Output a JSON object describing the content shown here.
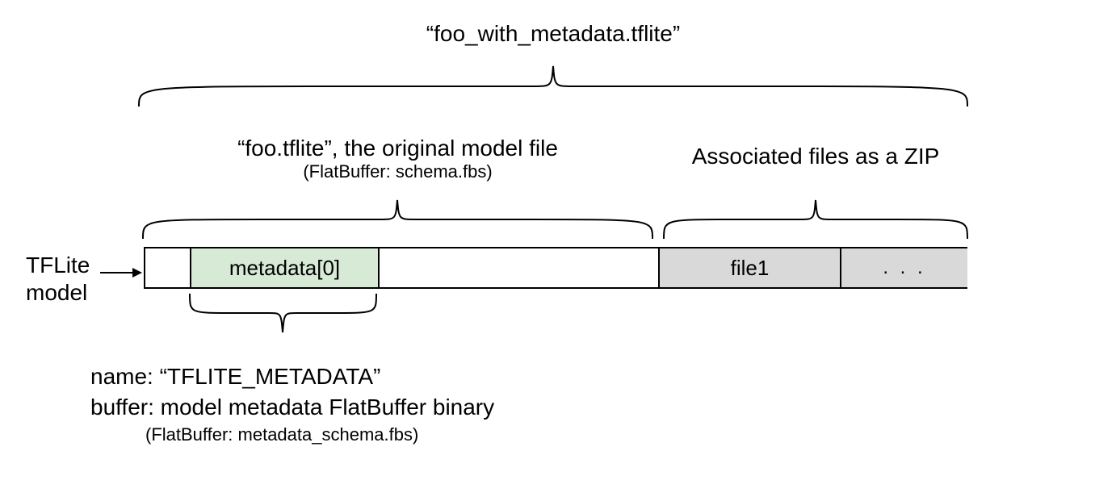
{
  "title": "“foo_with_metadata.tflite”",
  "original_label_line1": "“foo.tflite”, the original model file",
  "original_label_line2": "(FlatBuffer: schema.fbs)",
  "zip_label": "Associated files as a ZIP",
  "left_label_line1": "TFLite",
  "left_label_line2": "model",
  "segments": {
    "metadata": "metadata[0]",
    "file1": "file1",
    "dots": ". . ."
  },
  "detail_line1": "name: “TFLITE_METADATA”",
  "detail_line2": "buffer: model metadata FlatBuffer binary",
  "detail_line3": "(FlatBuffer: metadata_schema.fbs)"
}
